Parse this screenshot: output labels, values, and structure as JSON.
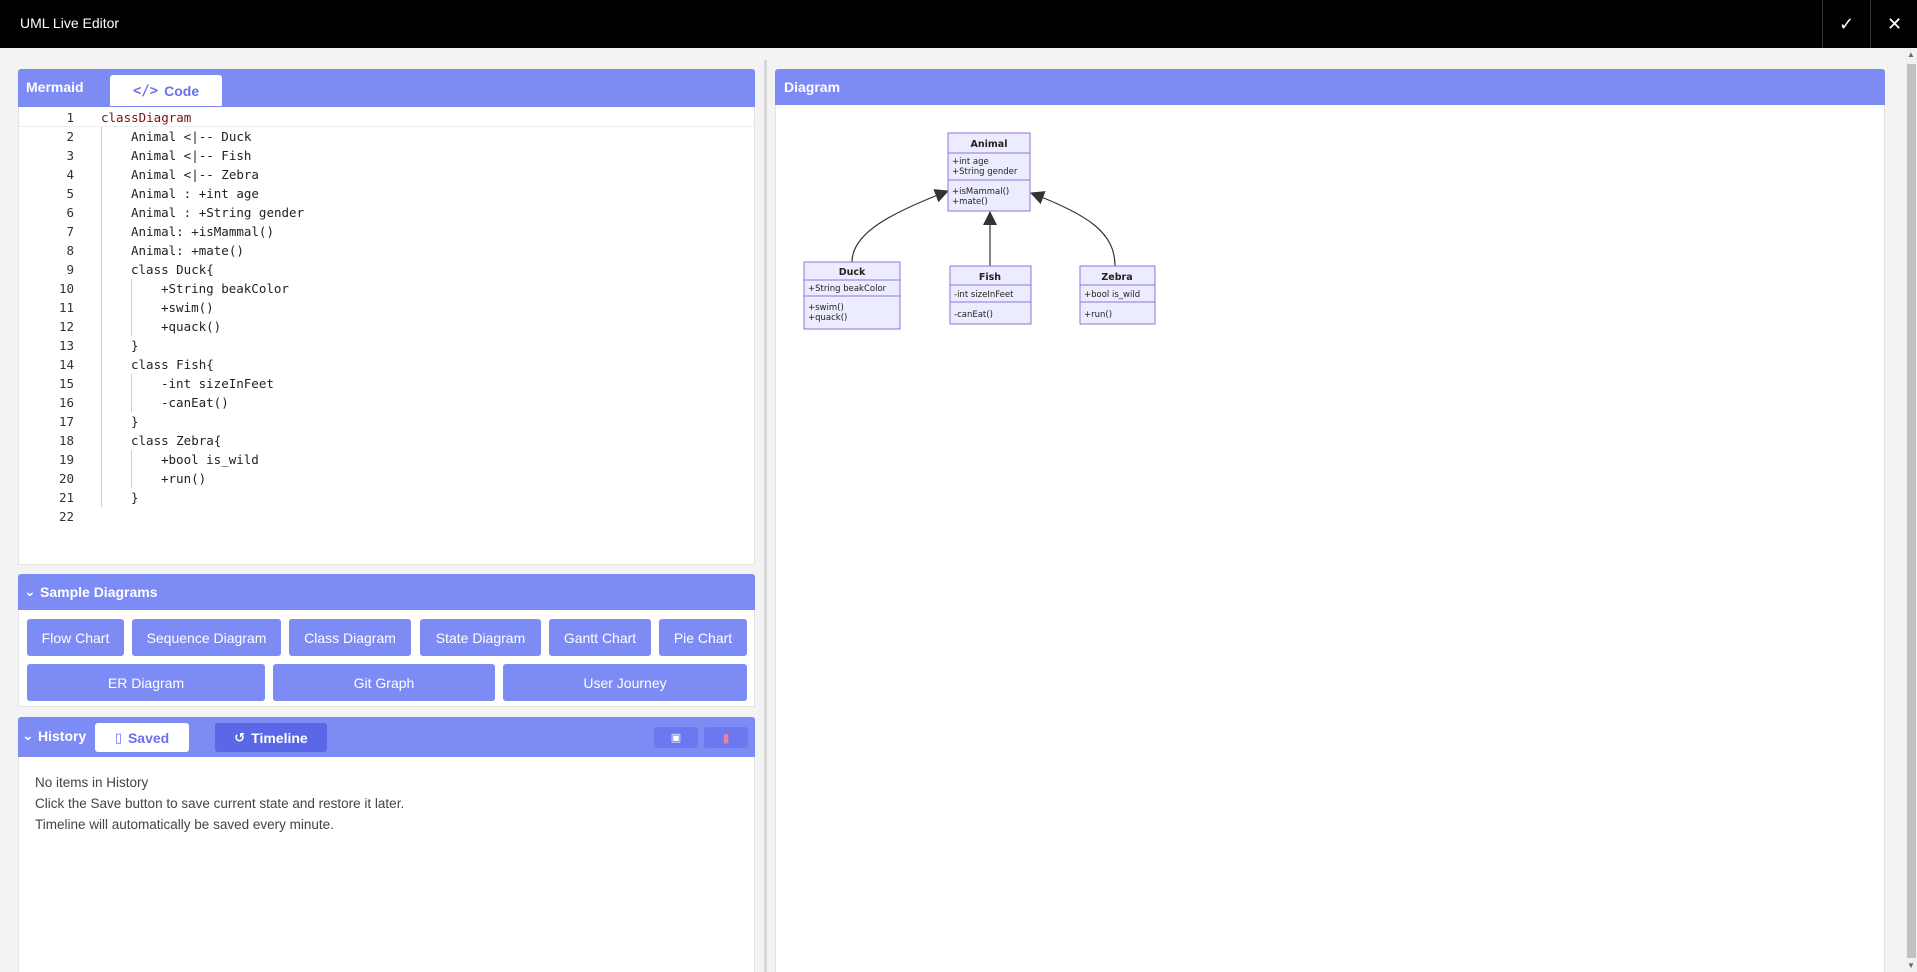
{
  "window": {
    "title": "UML Live Editor"
  },
  "editor": {
    "panel_label": "Mermaid",
    "tab_label": "Code",
    "lines": [
      {
        "n": "1",
        "indent": 0,
        "text": "classDiagram",
        "kw": true
      },
      {
        "n": "2",
        "indent": 1,
        "text": "Animal <|-- Duck"
      },
      {
        "n": "3",
        "indent": 1,
        "text": "Animal <|-- Fish"
      },
      {
        "n": "4",
        "indent": 1,
        "text": "Animal <|-- Zebra"
      },
      {
        "n": "5",
        "indent": 1,
        "text": "Animal : +int age"
      },
      {
        "n": "6",
        "indent": 1,
        "text": "Animal : +String gender"
      },
      {
        "n": "7",
        "indent": 1,
        "text": "Animal: +isMammal()"
      },
      {
        "n": "8",
        "indent": 1,
        "text": "Animal: +mate()"
      },
      {
        "n": "9",
        "indent": 1,
        "text": "class Duck{"
      },
      {
        "n": "10",
        "indent": 2,
        "text": "+String beakColor"
      },
      {
        "n": "11",
        "indent": 2,
        "text": "+swim()"
      },
      {
        "n": "12",
        "indent": 2,
        "text": "+quack()"
      },
      {
        "n": "13",
        "indent": 1,
        "text": "}"
      },
      {
        "n": "14",
        "indent": 1,
        "text": "class Fish{"
      },
      {
        "n": "15",
        "indent": 2,
        "text": "-int sizeInFeet"
      },
      {
        "n": "16",
        "indent": 2,
        "text": "-canEat()"
      },
      {
        "n": "17",
        "indent": 1,
        "text": "}"
      },
      {
        "n": "18",
        "indent": 1,
        "text": "class Zebra{"
      },
      {
        "n": "19",
        "indent": 2,
        "text": "+bool is_wild"
      },
      {
        "n": "20",
        "indent": 2,
        "text": "+run()"
      },
      {
        "n": "21",
        "indent": 1,
        "text": "}"
      },
      {
        "n": "22",
        "indent": 0,
        "text": ""
      }
    ]
  },
  "samples": {
    "header": "Sample Diagrams",
    "row1": [
      "Flow Chart",
      "Sequence Diagram",
      "Class Diagram",
      "State Diagram",
      "Gantt Chart",
      "Pie Chart"
    ],
    "row2": [
      "ER Diagram",
      "Git Graph",
      "User Journey"
    ]
  },
  "history": {
    "header": "History",
    "tab_saved": "Saved",
    "tab_timeline": "Timeline",
    "messages": [
      "No items in History",
      "Click the Save button to save current state and restore it later.",
      "Timeline will automatically be saved every minute."
    ]
  },
  "diagram": {
    "header": "Diagram",
    "classes": [
      {
        "id": "animal",
        "name": "Animal",
        "attributes": [
          "+int age",
          "+String gender"
        ],
        "methods": [
          "+isMammal()",
          "+mate()"
        ]
      },
      {
        "id": "duck",
        "name": "Duck",
        "attributes": [
          "+String beakColor"
        ],
        "methods": [
          "+swim()",
          "+quack()"
        ]
      },
      {
        "id": "fish",
        "name": "Fish",
        "attributes": [
          "-int sizeInFeet"
        ],
        "methods": [
          "-canEat()"
        ]
      },
      {
        "id": "zebra",
        "name": "Zebra",
        "attributes": [
          "+bool is_wild"
        ],
        "methods": [
          "+run()"
        ]
      }
    ]
  },
  "colors": {
    "accent": "#7d8bf5",
    "accent_dark": "#5a68e8",
    "delete": "#f07f99",
    "uml_fill": "#ececff",
    "uml_stroke": "#9370db"
  },
  "icons": {
    "confirm": "check-icon",
    "close": "close-icon"
  }
}
